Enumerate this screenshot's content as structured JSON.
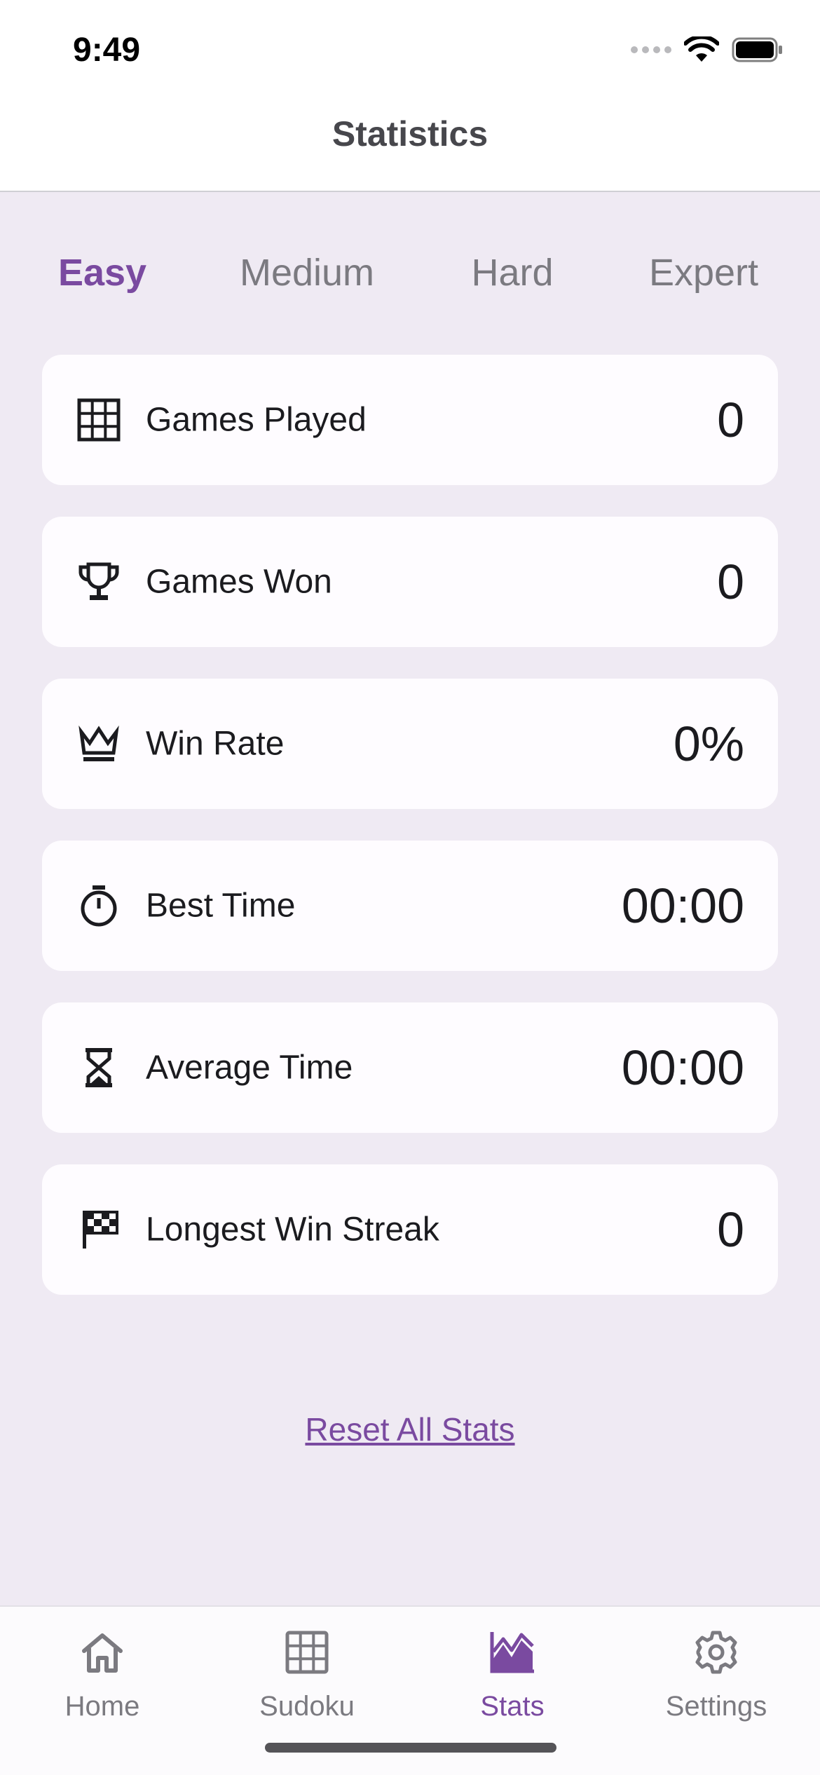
{
  "status_bar": {
    "time": "9:49"
  },
  "header": {
    "title": "Statistics"
  },
  "difficulty_tabs": [
    {
      "label": "Easy",
      "active": true
    },
    {
      "label": "Medium",
      "active": false
    },
    {
      "label": "Hard",
      "active": false
    },
    {
      "label": "Expert",
      "active": false
    }
  ],
  "stats": [
    {
      "icon": "grid-icon",
      "label": "Games Played",
      "value": "0"
    },
    {
      "icon": "trophy-icon",
      "label": "Games Won",
      "value": "0"
    },
    {
      "icon": "crown-icon",
      "label": "Win Rate",
      "value": "0%"
    },
    {
      "icon": "stopwatch-icon",
      "label": "Best Time",
      "value": "00:00"
    },
    {
      "icon": "hourglass-icon",
      "label": "Average Time",
      "value": "00:00"
    },
    {
      "icon": "checkered-flag-icon",
      "label": "Longest Win Streak",
      "value": "0"
    }
  ],
  "reset": {
    "label": "Reset All Stats"
  },
  "bottom_nav": [
    {
      "icon": "home-icon",
      "label": "Home",
      "active": false
    },
    {
      "icon": "grid-icon",
      "label": "Sudoku",
      "active": false
    },
    {
      "icon": "chart-icon",
      "label": "Stats",
      "active": true
    },
    {
      "icon": "gear-icon",
      "label": "Settings",
      "active": false
    }
  ],
  "colors": {
    "accent": "#7a4aa0",
    "background": "#efeaf3",
    "card": "#fefcff",
    "inactive": "#7b7a80"
  }
}
